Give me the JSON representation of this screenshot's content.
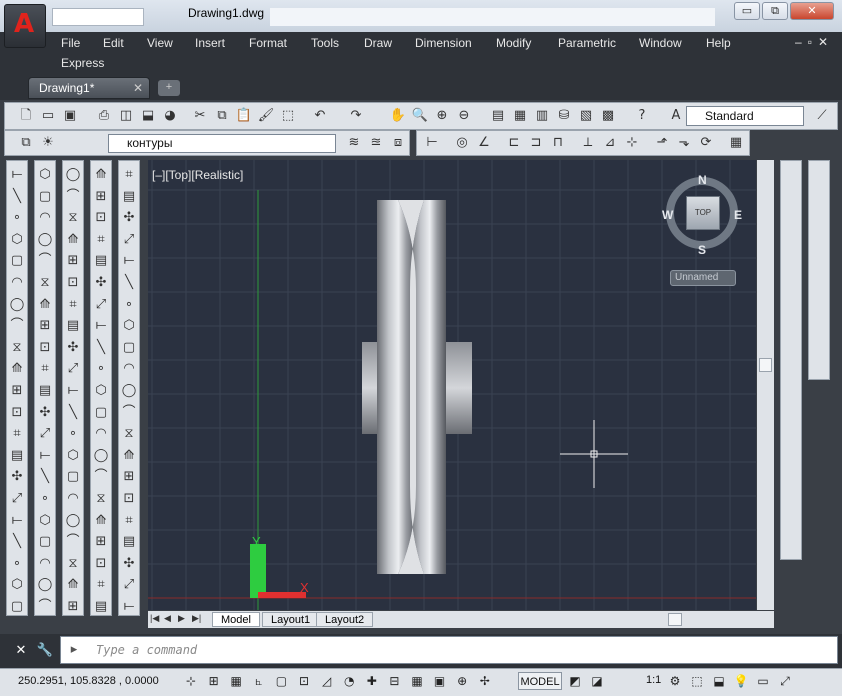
{
  "window": {
    "title": "Drawing1.dwg",
    "minimize": "▭",
    "restore": "⧉",
    "close": "✕"
  },
  "menu": {
    "items": [
      "File",
      "Edit",
      "View",
      "Insert",
      "Format",
      "Tools",
      "Draw",
      "Dimension",
      "Modify",
      "Parametric",
      "Window",
      "Help"
    ],
    "second_row": "Express",
    "mdi_controls": "–▫✕"
  },
  "tabs": {
    "doc": "Drawing1*",
    "close": "✕",
    "new": "+"
  },
  "toolbar": {
    "text_style": "Standard",
    "layer": "контуры"
  },
  "viewport": {
    "label": "[–][Top][Realistic]",
    "ucs": {
      "x": "X",
      "y": "Y"
    }
  },
  "navcube": {
    "n": "N",
    "s": "S",
    "e": "E",
    "w": "W",
    "face": "TOP",
    "ucs_menu": "Unnamed"
  },
  "layout_tabs": [
    "Model",
    "Layout1",
    "Layout2"
  ],
  "command": {
    "placeholder": "Type a command"
  },
  "status": {
    "coords": "250.2951, 105.8328 , 0.0000",
    "model": "MODEL",
    "scale": "1:1"
  },
  "colors": {
    "accent": "#e0231c",
    "viewport_bg": "#2a3140",
    "grid": "#3a4252",
    "y_axis": "#2ecc40",
    "x_axis": "#e03030"
  },
  "icons": [
    "autocad-logo-icon",
    "line-icon",
    "circle-icon",
    "pan-icon",
    "zoom-icon",
    "undo-icon",
    "redo-icon",
    "cursor-crosshair-icon"
  ]
}
